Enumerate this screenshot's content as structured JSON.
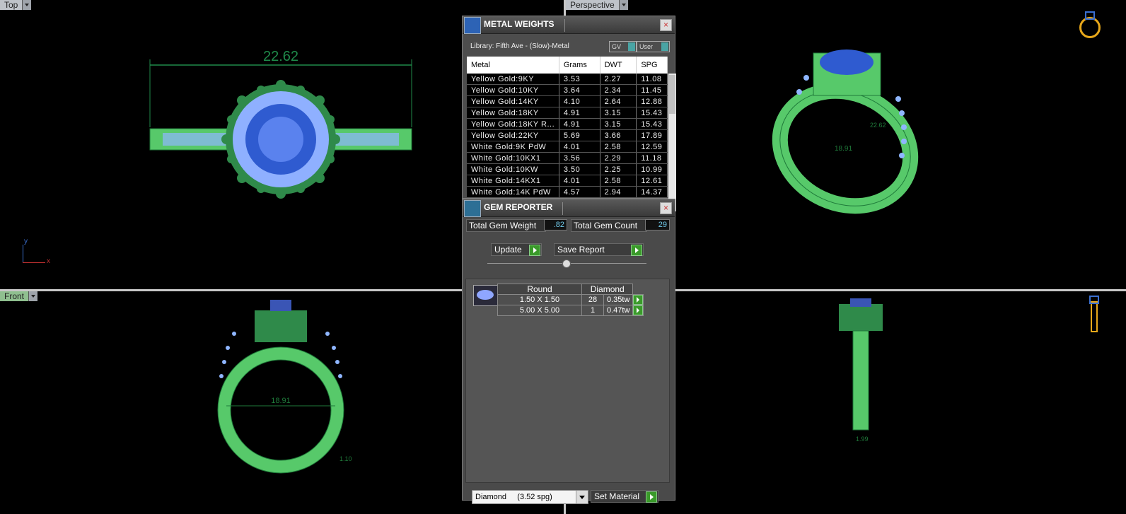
{
  "viewports": {
    "top": {
      "label": "Top",
      "dimension": "22.62"
    },
    "perspective": {
      "label": "Perspective",
      "dim_a": "18.91",
      "dim_b": "22.62"
    },
    "front": {
      "label": "Front",
      "dimension": "18.91",
      "dim_small": "1.10"
    },
    "side": {
      "dim_small": "1.99"
    }
  },
  "axis": {
    "y": "y",
    "x": "x"
  },
  "metal_weights": {
    "title": "METAL WEIGHTS",
    "library": "Library: Fifth Ave - (Slow)-Metal",
    "toggle_gv": "GV",
    "toggle_user": "User",
    "columns": [
      "Metal",
      "Grams",
      "DWT",
      "SPG"
    ],
    "rows": [
      [
        "Yellow Gold:9KY",
        "3.53",
        "2.27",
        "11.08"
      ],
      [
        "Yellow Gold:10KY",
        "3.64",
        "2.34",
        "11.45"
      ],
      [
        "Yellow Gold:14KY",
        "4.10",
        "2.64",
        "12.88"
      ],
      [
        "Yellow Gold:18KY",
        "4.91",
        "3.15",
        "15.43"
      ],
      [
        "Yellow Gold:18KY R...",
        "4.91",
        "3.15",
        "15.43"
      ],
      [
        "Yellow Gold:22KY",
        "5.69",
        "3.66",
        "17.89"
      ],
      [
        "White Gold:9K PdW",
        "4.01",
        "2.58",
        "12.59"
      ],
      [
        "White Gold:10KX1",
        "3.56",
        "2.29",
        "11.18"
      ],
      [
        "White Gold:10KW",
        "3.50",
        "2.25",
        "10.99"
      ],
      [
        "White Gold:14KX1",
        "4.01",
        "2.58",
        "12.61"
      ],
      [
        "White Gold:14K PdW",
        "4.57",
        "2.94",
        "14.37"
      ]
    ]
  },
  "gem_reporter": {
    "title": "GEM REPORTER",
    "total_weight_label": "Total Gem Weight",
    "total_weight_value": ".82",
    "total_count_label": "Total Gem Count",
    "total_count_value": "29",
    "update_label": "Update",
    "save_label": "Save Report",
    "shape": "Round",
    "material": "Diamond",
    "gems": [
      {
        "size": "1.50 X 1.50",
        "count": "28",
        "weight": "0.35tw"
      },
      {
        "size": "5.00 X 5.00",
        "count": "1",
        "weight": "0.47tw"
      }
    ],
    "select_value": "Diamond     (3.52 spg)",
    "set_material_label": "Set Material"
  }
}
